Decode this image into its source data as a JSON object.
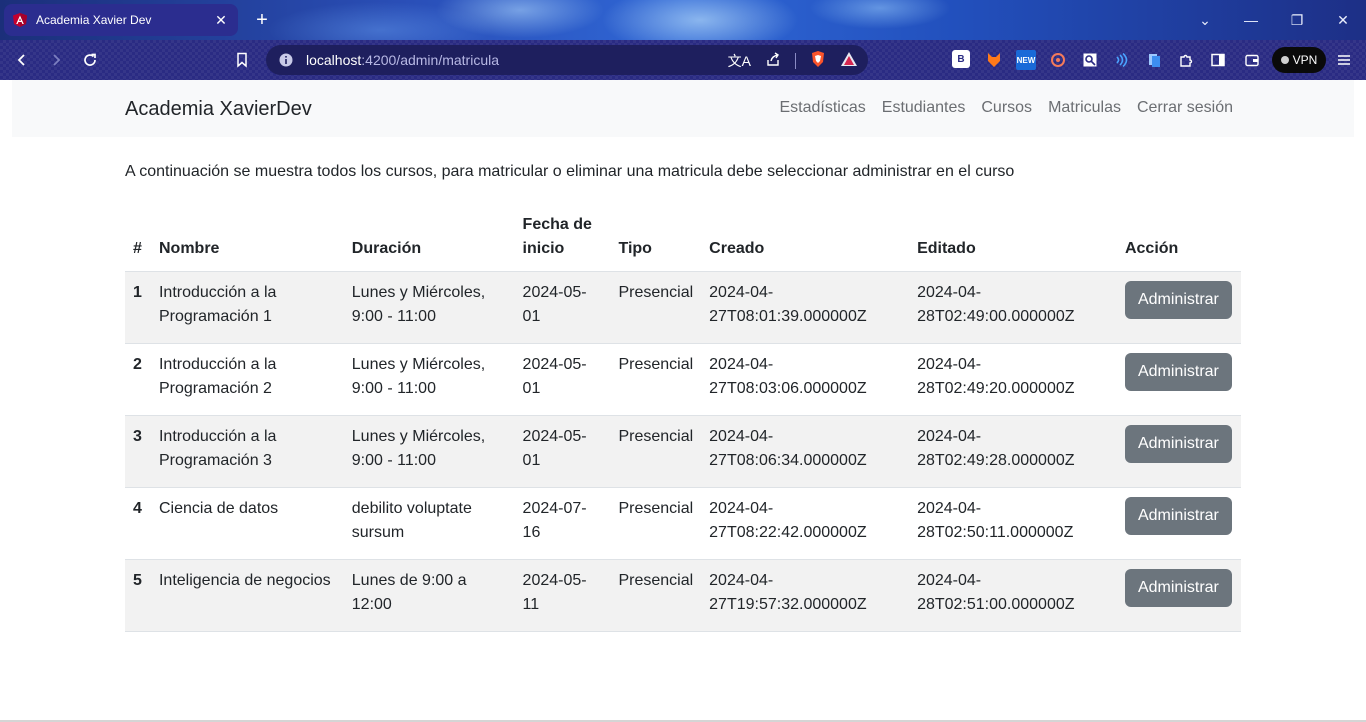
{
  "browser": {
    "tab_title": "Academia Xavier Dev",
    "new_tab": "+",
    "url_host": "localhost",
    "url_path": ":4200/admin/matricula",
    "vpn_label": "VPN",
    "extension_labels": {
      "b": "B",
      "new": "NEW"
    }
  },
  "navbar": {
    "brand": "Academia XavierDev",
    "links": [
      "Estadísticas",
      "Estudiantes",
      "Cursos",
      "Matriculas",
      "Cerrar sesión"
    ]
  },
  "intro": "A continuación se muestra todos los cursos, para matricular o eliminar una matricula debe seleccionar administrar en el curso",
  "table": {
    "headers": [
      "#",
      "Nombre",
      "Duración",
      "Fecha de inicio",
      "Tipo",
      "Creado",
      "Editado",
      "Acción"
    ],
    "rows": [
      {
        "num": "1",
        "nombre": "Introducción a la Programación 1",
        "duracion": "Lunes y Miércoles, 9:00 - 11:00",
        "fecha": "2024-05-01",
        "tipo": "Presencial",
        "creado": "2024-04-27T08:01:39.000000Z",
        "editado": "2024-04-28T02:49:00.000000Z",
        "accion": "Administrar"
      },
      {
        "num": "2",
        "nombre": "Introducción a la Programación 2",
        "duracion": "Lunes y Miércoles, 9:00 - 11:00",
        "fecha": "2024-05-01",
        "tipo": "Presencial",
        "creado": "2024-04-27T08:03:06.000000Z",
        "editado": "2024-04-28T02:49:20.000000Z",
        "accion": "Administrar"
      },
      {
        "num": "3",
        "nombre": "Introducción a la Programación 3",
        "duracion": "Lunes y Miércoles, 9:00 - 11:00",
        "fecha": "2024-05-01",
        "tipo": "Presencial",
        "creado": "2024-04-27T08:06:34.000000Z",
        "editado": "2024-04-28T02:49:28.000000Z",
        "accion": "Administrar"
      },
      {
        "num": "4",
        "nombre": "Ciencia de datos",
        "duracion": "debilito voluptate sursum",
        "fecha": "2024-07-16",
        "tipo": "Presencial",
        "creado": "2024-04-27T08:22:42.000000Z",
        "editado": "2024-04-28T02:50:11.000000Z",
        "accion": "Administrar"
      },
      {
        "num": "5",
        "nombre": "Inteligencia de negocios",
        "duracion": "Lunes de 9:00 a 12:00",
        "fecha": "2024-05-11",
        "tipo": "Presencial",
        "creado": "2024-04-27T19:57:32.000000Z",
        "editado": "2024-04-28T02:51:00.000000Z",
        "accion": "Administrar"
      }
    ]
  },
  "colors": {
    "button_bg": "#6c757d",
    "navbar_bg": "#f8f9fa",
    "stripe_bg": "#f2f2f2"
  }
}
